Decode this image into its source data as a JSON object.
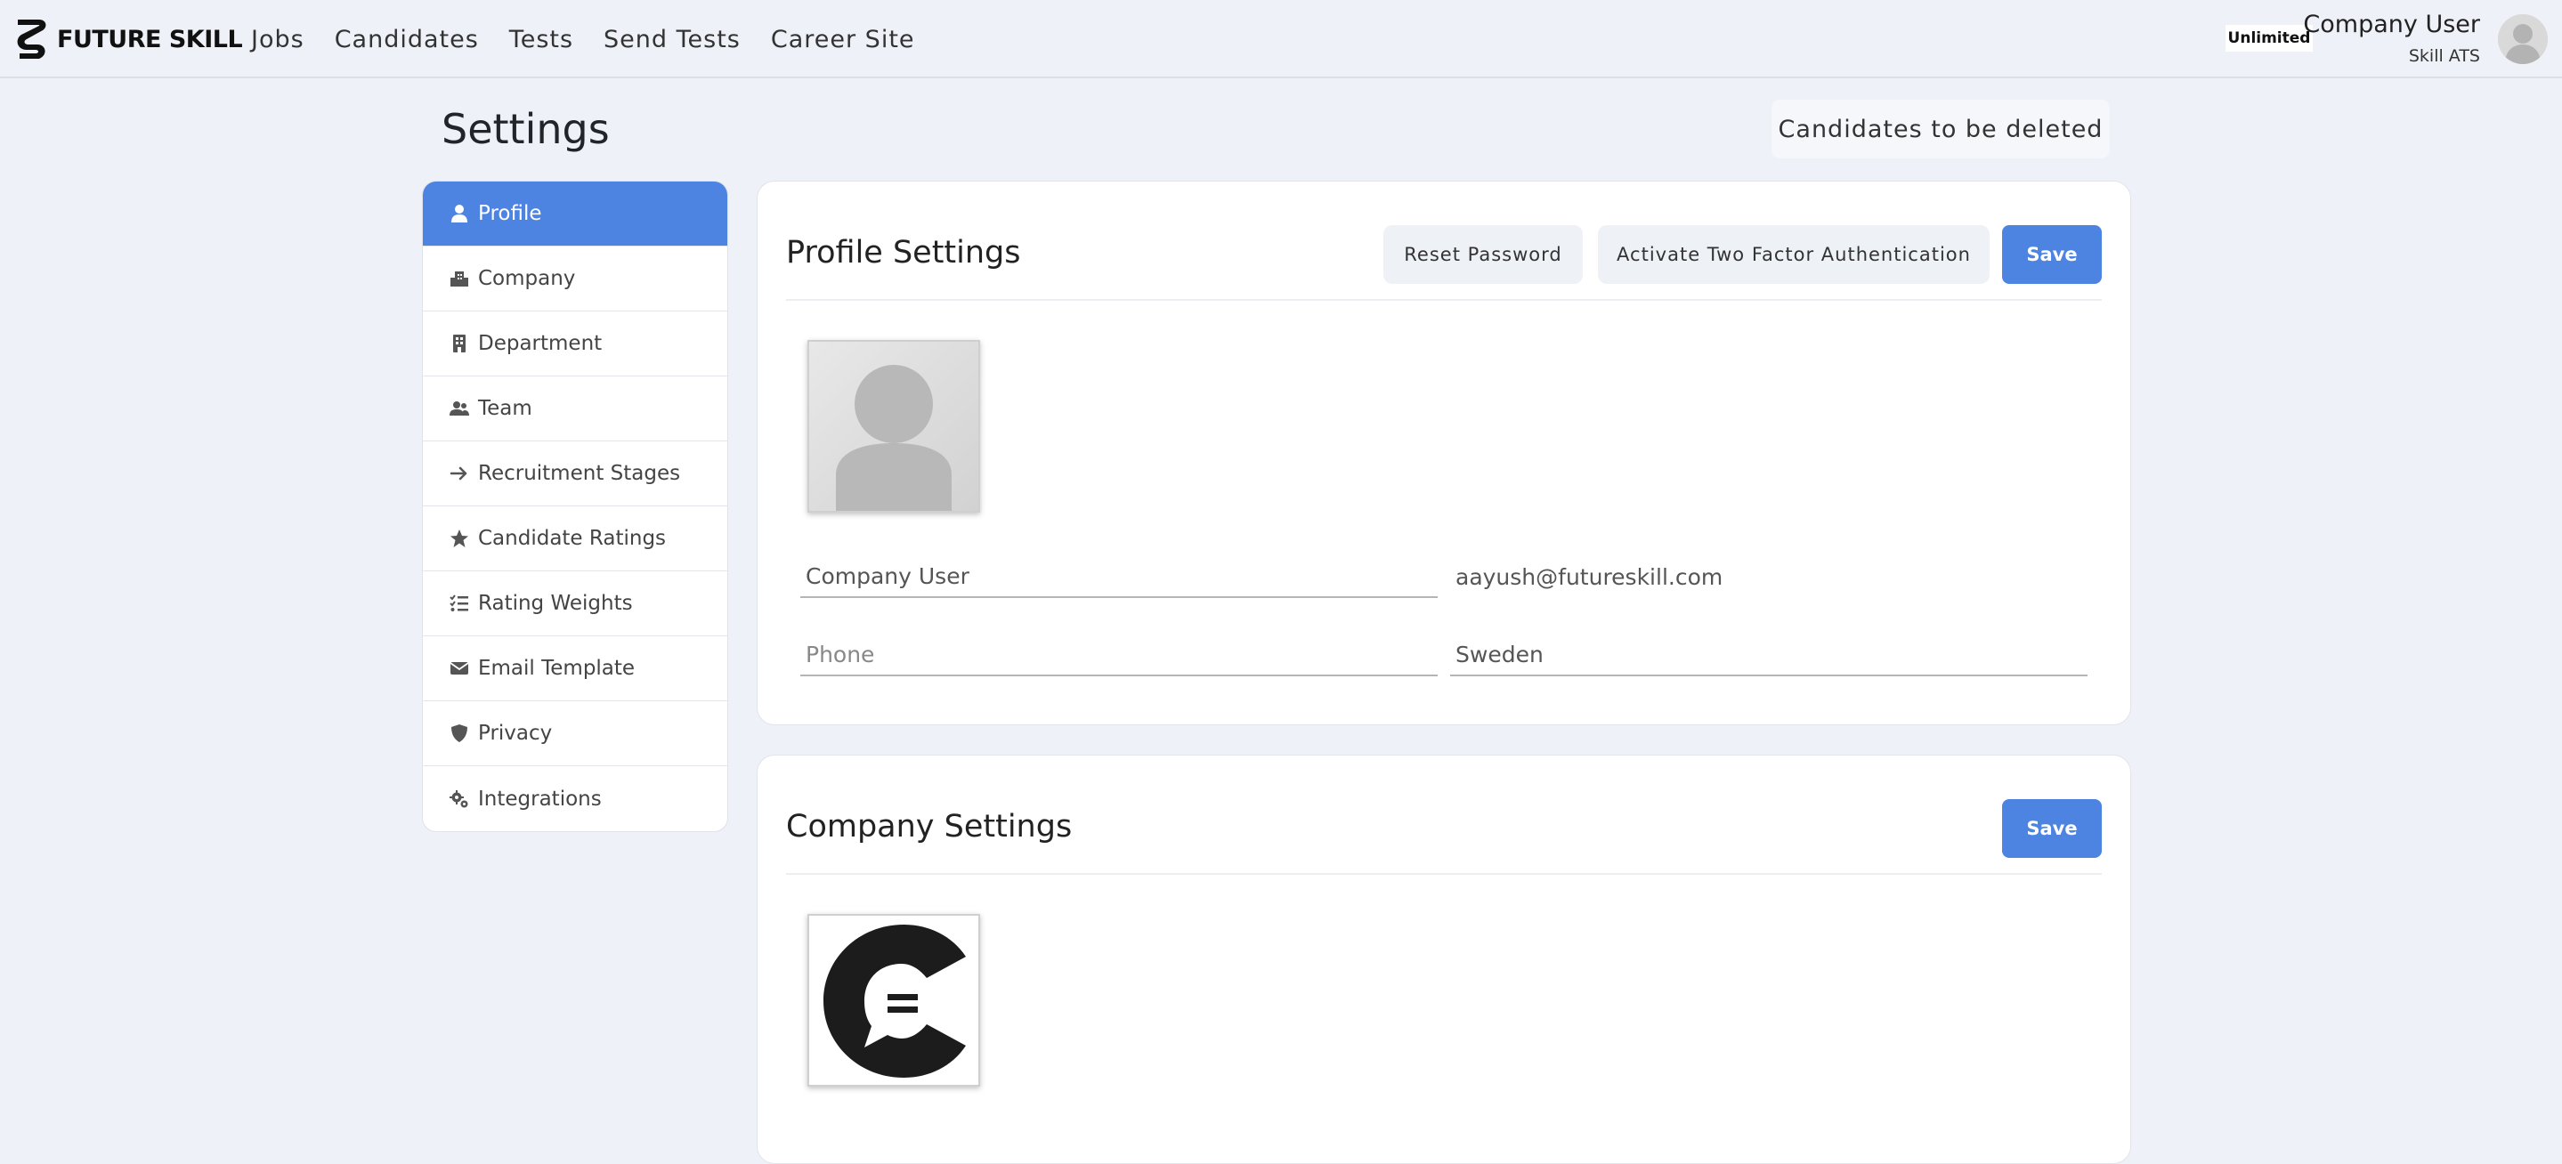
{
  "brand": {
    "name": "FUTURE SKILL"
  },
  "nav": {
    "links": [
      "Jobs",
      "Candidates",
      "Tests",
      "Send Tests",
      "Career Site"
    ]
  },
  "user": {
    "plan_badge": "Unlimited",
    "name": "Company User",
    "product": "Skill ATS"
  },
  "page": {
    "title": "Settings",
    "candidates_deleted_label": "Candidates to be deleted"
  },
  "sidebar": {
    "items": [
      {
        "label": "Profile",
        "icon": "user-icon",
        "active": true
      },
      {
        "label": "Company",
        "icon": "building-group-icon"
      },
      {
        "label": "Department",
        "icon": "building-icon"
      },
      {
        "label": "Team",
        "icon": "users-icon"
      },
      {
        "label": "Recruitment Stages",
        "icon": "arrow-right-icon"
      },
      {
        "label": "Candidate Ratings",
        "icon": "star-icon"
      },
      {
        "label": "Rating Weights",
        "icon": "list-check-icon"
      },
      {
        "label": "Email Template",
        "icon": "envelope-icon"
      },
      {
        "label": "Privacy",
        "icon": "shield-icon"
      },
      {
        "label": "Integrations",
        "icon": "gears-icon"
      }
    ]
  },
  "profile": {
    "title": "Profile Settings",
    "reset_password_label": "Reset Password",
    "two_factor_label": "Activate Two Factor Authentication",
    "save_label": "Save",
    "name_value": "Company User",
    "email_value": "aayush@futureskill.com",
    "phone_value": "",
    "phone_placeholder": "Phone",
    "country_value": "Sweden"
  },
  "company": {
    "title": "Company Settings",
    "save_label": "Save"
  },
  "colors": {
    "primary": "#4d84e2",
    "background": "#eef1f8"
  }
}
